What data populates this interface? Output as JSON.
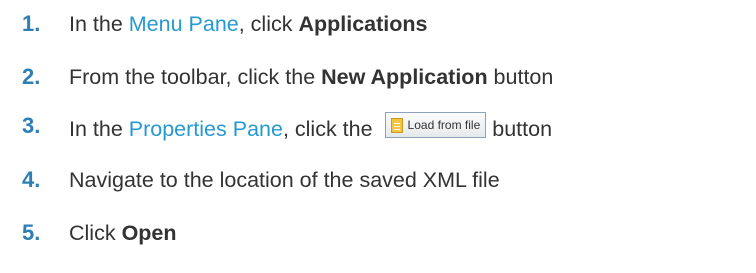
{
  "steps": [
    {
      "num": "1.",
      "pre": "In the ",
      "link": "Menu Pane",
      "mid": ", click ",
      "bold": "Applications"
    },
    {
      "num": "2.",
      "pre": "From the toolbar, click the ",
      "bold": "New Application",
      "post": " button"
    },
    {
      "num": "3.",
      "pre": "In the ",
      "link": "Properties Pane",
      "mid": ", click the ",
      "button": "Load from file",
      "post": "button"
    },
    {
      "num": "4.",
      "text": "Navigate to the location of the saved XML file"
    },
    {
      "num": "5.",
      "pre": "Click ",
      "bold": "Open"
    }
  ],
  "icons": {
    "load_button_icon": "file-icon"
  },
  "colors": {
    "number": "#2e7fb3",
    "link": "#2699d1",
    "text": "#333333"
  }
}
